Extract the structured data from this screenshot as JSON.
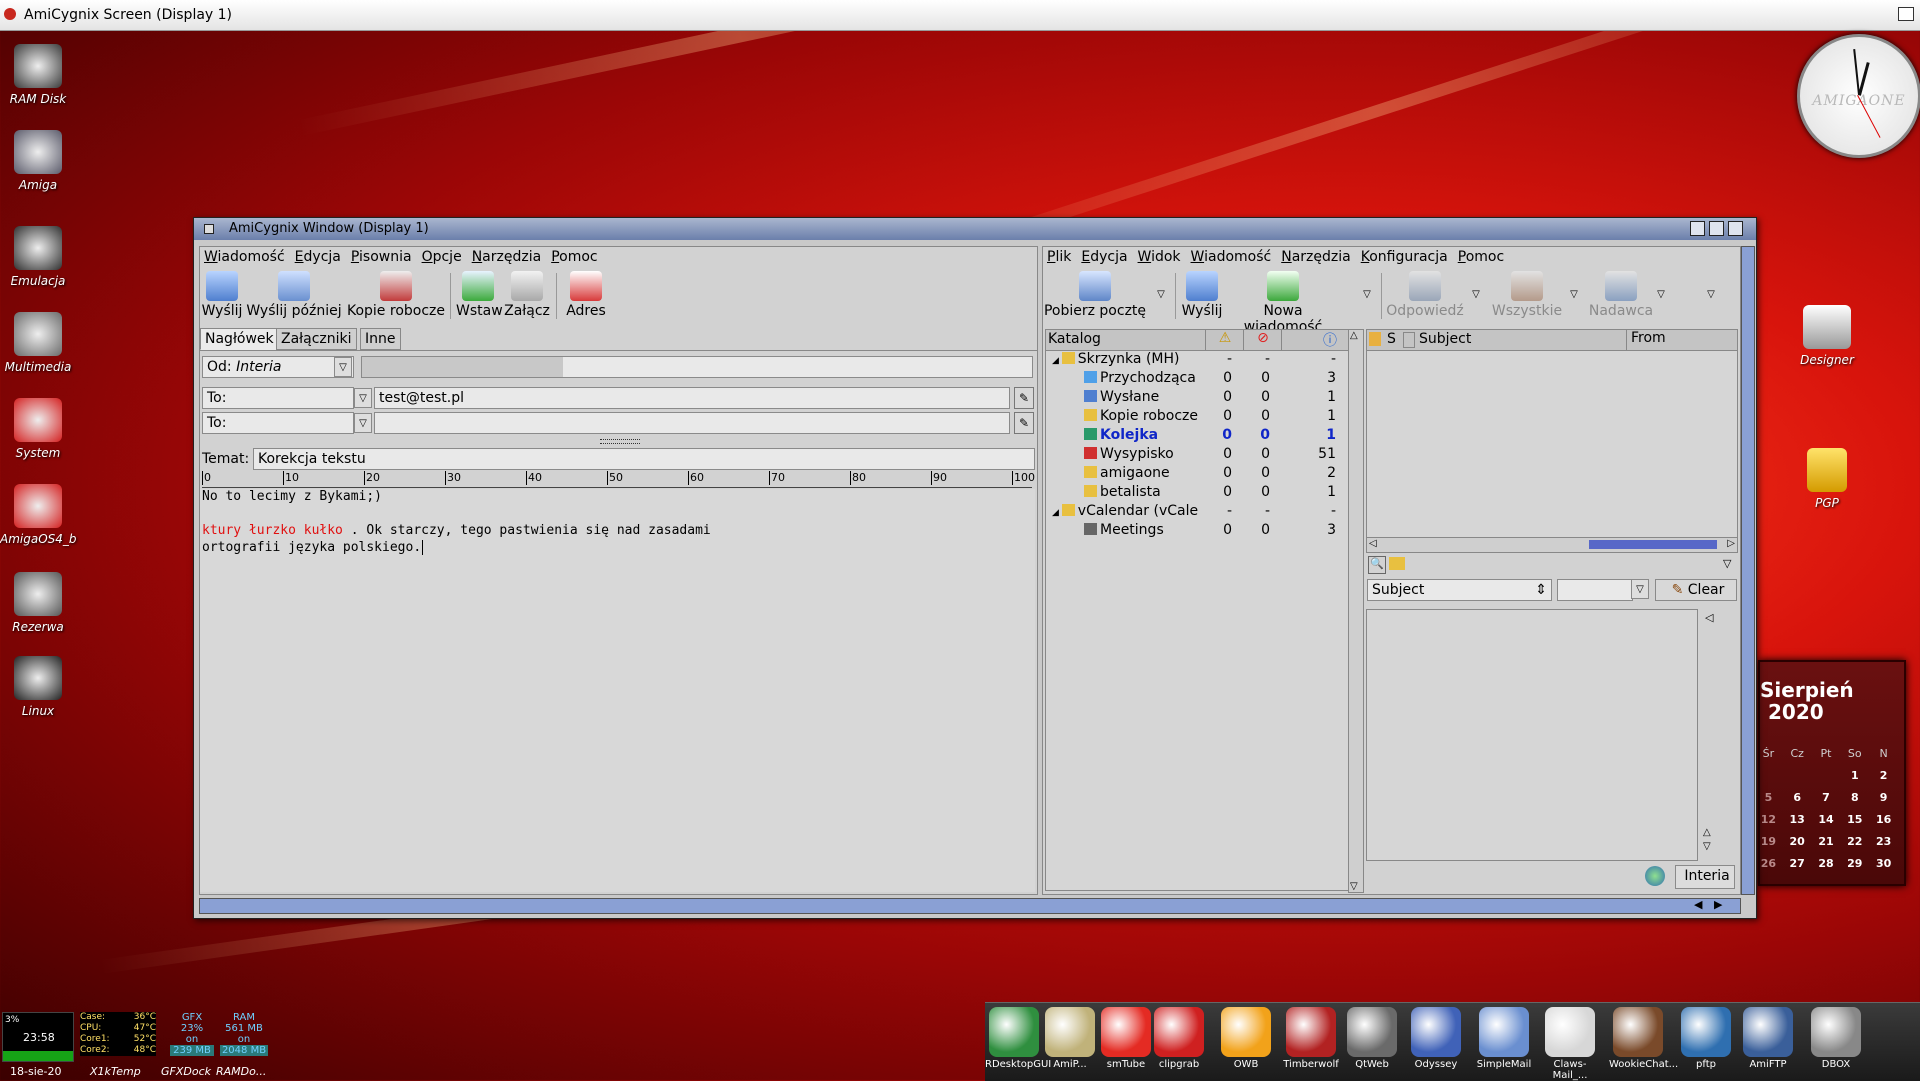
{
  "screen": {
    "title": "AmiCygnix Screen (Display 1)"
  },
  "desktop_icons": [
    {
      "label": "RAM Disk",
      "icon": "ram-disk-icon"
    },
    {
      "label": "Amiga",
      "icon": "tools-icon"
    },
    {
      "label": "Emulacja",
      "icon": "joystick-icon"
    },
    {
      "label": "Multimedia",
      "icon": "film-reel-icon"
    },
    {
      "label": "System",
      "icon": "boing-ball-icon"
    },
    {
      "label": "AmigaOS4_b",
      "icon": "boing-ball-icon"
    },
    {
      "label": "Rezerwa",
      "icon": "drive-icon"
    },
    {
      "label": "Linux",
      "icon": "tux-icon"
    }
  ],
  "right_icons": [
    {
      "label": "Designer",
      "icon": "hollywood-clapper-icon"
    },
    {
      "label": "PGP",
      "icon": "padlock-icon"
    }
  ],
  "clock": {
    "brand": "AMIGAONE"
  },
  "window": {
    "title": "AmiCygnix Window (Display 1)",
    "compose": {
      "menu": [
        "Wiadomość",
        "Edycja",
        "Pisownia",
        "Opcje",
        "Narzędzia",
        "Pomoc"
      ],
      "toolbar": [
        "Wyślij",
        "Wyślij później",
        "Kopie robocze",
        "Wstaw",
        "Załącz",
        "Adres"
      ],
      "tabs": [
        "Nagłówek",
        "Załączniki",
        "Inne"
      ],
      "from_label": "Od:",
      "from_value": "Interia",
      "to_label": "To:",
      "to_value": "test@test.pl",
      "to2_label": "To:",
      "subject_label": "Temat:",
      "subject_value": "Korekcja tekstu",
      "ruler": [
        "0",
        "10",
        "20",
        "30",
        "40",
        "50",
        "60",
        "70",
        "80",
        "90",
        "100"
      ],
      "body_line1": "No to lecimy z Bykami;)",
      "body_misspelled": "ktury łurzko kułko",
      "body_rest": " . Ok starczy, tego pastwienia się nad zasadami",
      "body_line3": "ortografii języka polskiego."
    },
    "mail": {
      "menu": [
        "Plik",
        "Edycja",
        "Widok",
        "Wiadomość",
        "Narzędzia",
        "Konfiguracja",
        "Pomoc"
      ],
      "toolbar": [
        "Pobierz pocztę",
        "Wyślij",
        "Nowa wiadomość",
        "Odpowiedź",
        "Wszystkie",
        "Nadawca"
      ],
      "folder_header": "Katalog",
      "folders": [
        {
          "name": "Skrzynka (MH)",
          "a": "-",
          "b": "-",
          "c": "-",
          "level": 0,
          "bold": false
        },
        {
          "name": "Przychodząca",
          "a": "0",
          "b": "0",
          "c": "3",
          "level": 1,
          "bold": false
        },
        {
          "name": "Wysłane",
          "a": "0",
          "b": "0",
          "c": "1",
          "level": 1,
          "bold": false
        },
        {
          "name": "Kopie robocze",
          "a": "0",
          "b": "0",
          "c": "1",
          "level": 1,
          "bold": false
        },
        {
          "name": "Kolejka",
          "a": "0",
          "b": "0",
          "c": "1",
          "level": 1,
          "bold": true
        },
        {
          "name": "Wysypisko",
          "a": "0",
          "b": "0",
          "c": "51",
          "level": 1,
          "bold": false
        },
        {
          "name": "amigaone",
          "a": "0",
          "b": "0",
          "c": "2",
          "level": 1,
          "bold": false
        },
        {
          "name": "betalista",
          "a": "0",
          "b": "0",
          "c": "1",
          "level": 1,
          "bold": false
        },
        {
          "name": "vCalendar (vCale",
          "a": "-",
          "b": "-",
          "c": "-",
          "level": 0,
          "bold": false
        },
        {
          "name": "Meetings",
          "a": "0",
          "b": "0",
          "c": "3",
          "level": 1,
          "bold": false
        }
      ],
      "list_headers": {
        "s": "S",
        "subject": "Subject",
        "from": "From"
      },
      "search_field": "Subject",
      "clear_label": "Clear",
      "account_label": "Interia"
    }
  },
  "calendar": {
    "month": "Sierpień",
    "year": "2020",
    "headers": [
      "Śr",
      "Cz",
      "Pt",
      "So",
      "N"
    ],
    "weeks": [
      [
        "",
        "",
        "",
        "1",
        "2"
      ],
      [
        "5",
        "6",
        "7",
        "8",
        "9"
      ],
      [
        "12",
        "13",
        "14",
        "15",
        "16"
      ],
      [
        "19",
        "20",
        "21",
        "22",
        "23"
      ],
      [
        "26",
        "27",
        "28",
        "29",
        "30"
      ]
    ]
  },
  "monitor": {
    "cpu_pct": "3%",
    "time": "23:58",
    "date": "18-sie-20",
    "temps": [
      [
        "Case:",
        "36°C"
      ],
      [
        "CPU:",
        "47°C"
      ],
      [
        "Core1:",
        "52°C"
      ],
      [
        "Core2:",
        "48°C"
      ]
    ],
    "gfx": [
      "GFX",
      "23%",
      "on",
      "239 MB"
    ],
    "ram": [
      "RAM",
      "561 MB",
      "on",
      "2048 MB"
    ],
    "labels": [
      "X1kTemp",
      "GFXDock",
      "RAMDo..."
    ]
  },
  "dock": [
    {
      "label": "RDesktopGUI",
      "icon": "remote-desktop-icon",
      "color": "#2f8f3f"
    },
    {
      "label": "AmiP...",
      "icon": "ami-p-icon",
      "color": "#c0b27a"
    },
    {
      "label": "smTube",
      "icon": "youtube-icon",
      "color": "#e42b23"
    },
    {
      "label": "clipgrab",
      "icon": "youtube-icon",
      "color": "#cf2020"
    },
    {
      "label": "OWB",
      "icon": "owb-icon",
      "color": "#f2a21a"
    },
    {
      "label": "Timberwolf",
      "icon": "boing-ball-icon",
      "color": "#b22222"
    },
    {
      "label": "QtWeb",
      "icon": "qt-icon",
      "color": "#6a6a6a"
    },
    {
      "label": "Odyssey",
      "icon": "globe-icon",
      "color": "#4062b8"
    },
    {
      "label": "SimpleMail",
      "icon": "mail-icon",
      "color": "#6a8fd0"
    },
    {
      "label": "Claws-Mail_...",
      "icon": "claws-mail-icon",
      "color": "#d7d7d7"
    },
    {
      "label": "WookieChat...",
      "icon": "wookie-icon",
      "color": "#7a4a2a"
    },
    {
      "label": "pftp",
      "icon": "ftp-icon",
      "color": "#2f6fb0"
    },
    {
      "label": "AmiFTP",
      "icon": "globe-icon",
      "color": "#3a5f9a"
    },
    {
      "label": "DBOX",
      "icon": "dbox-icon",
      "color": "#888888"
    }
  ]
}
